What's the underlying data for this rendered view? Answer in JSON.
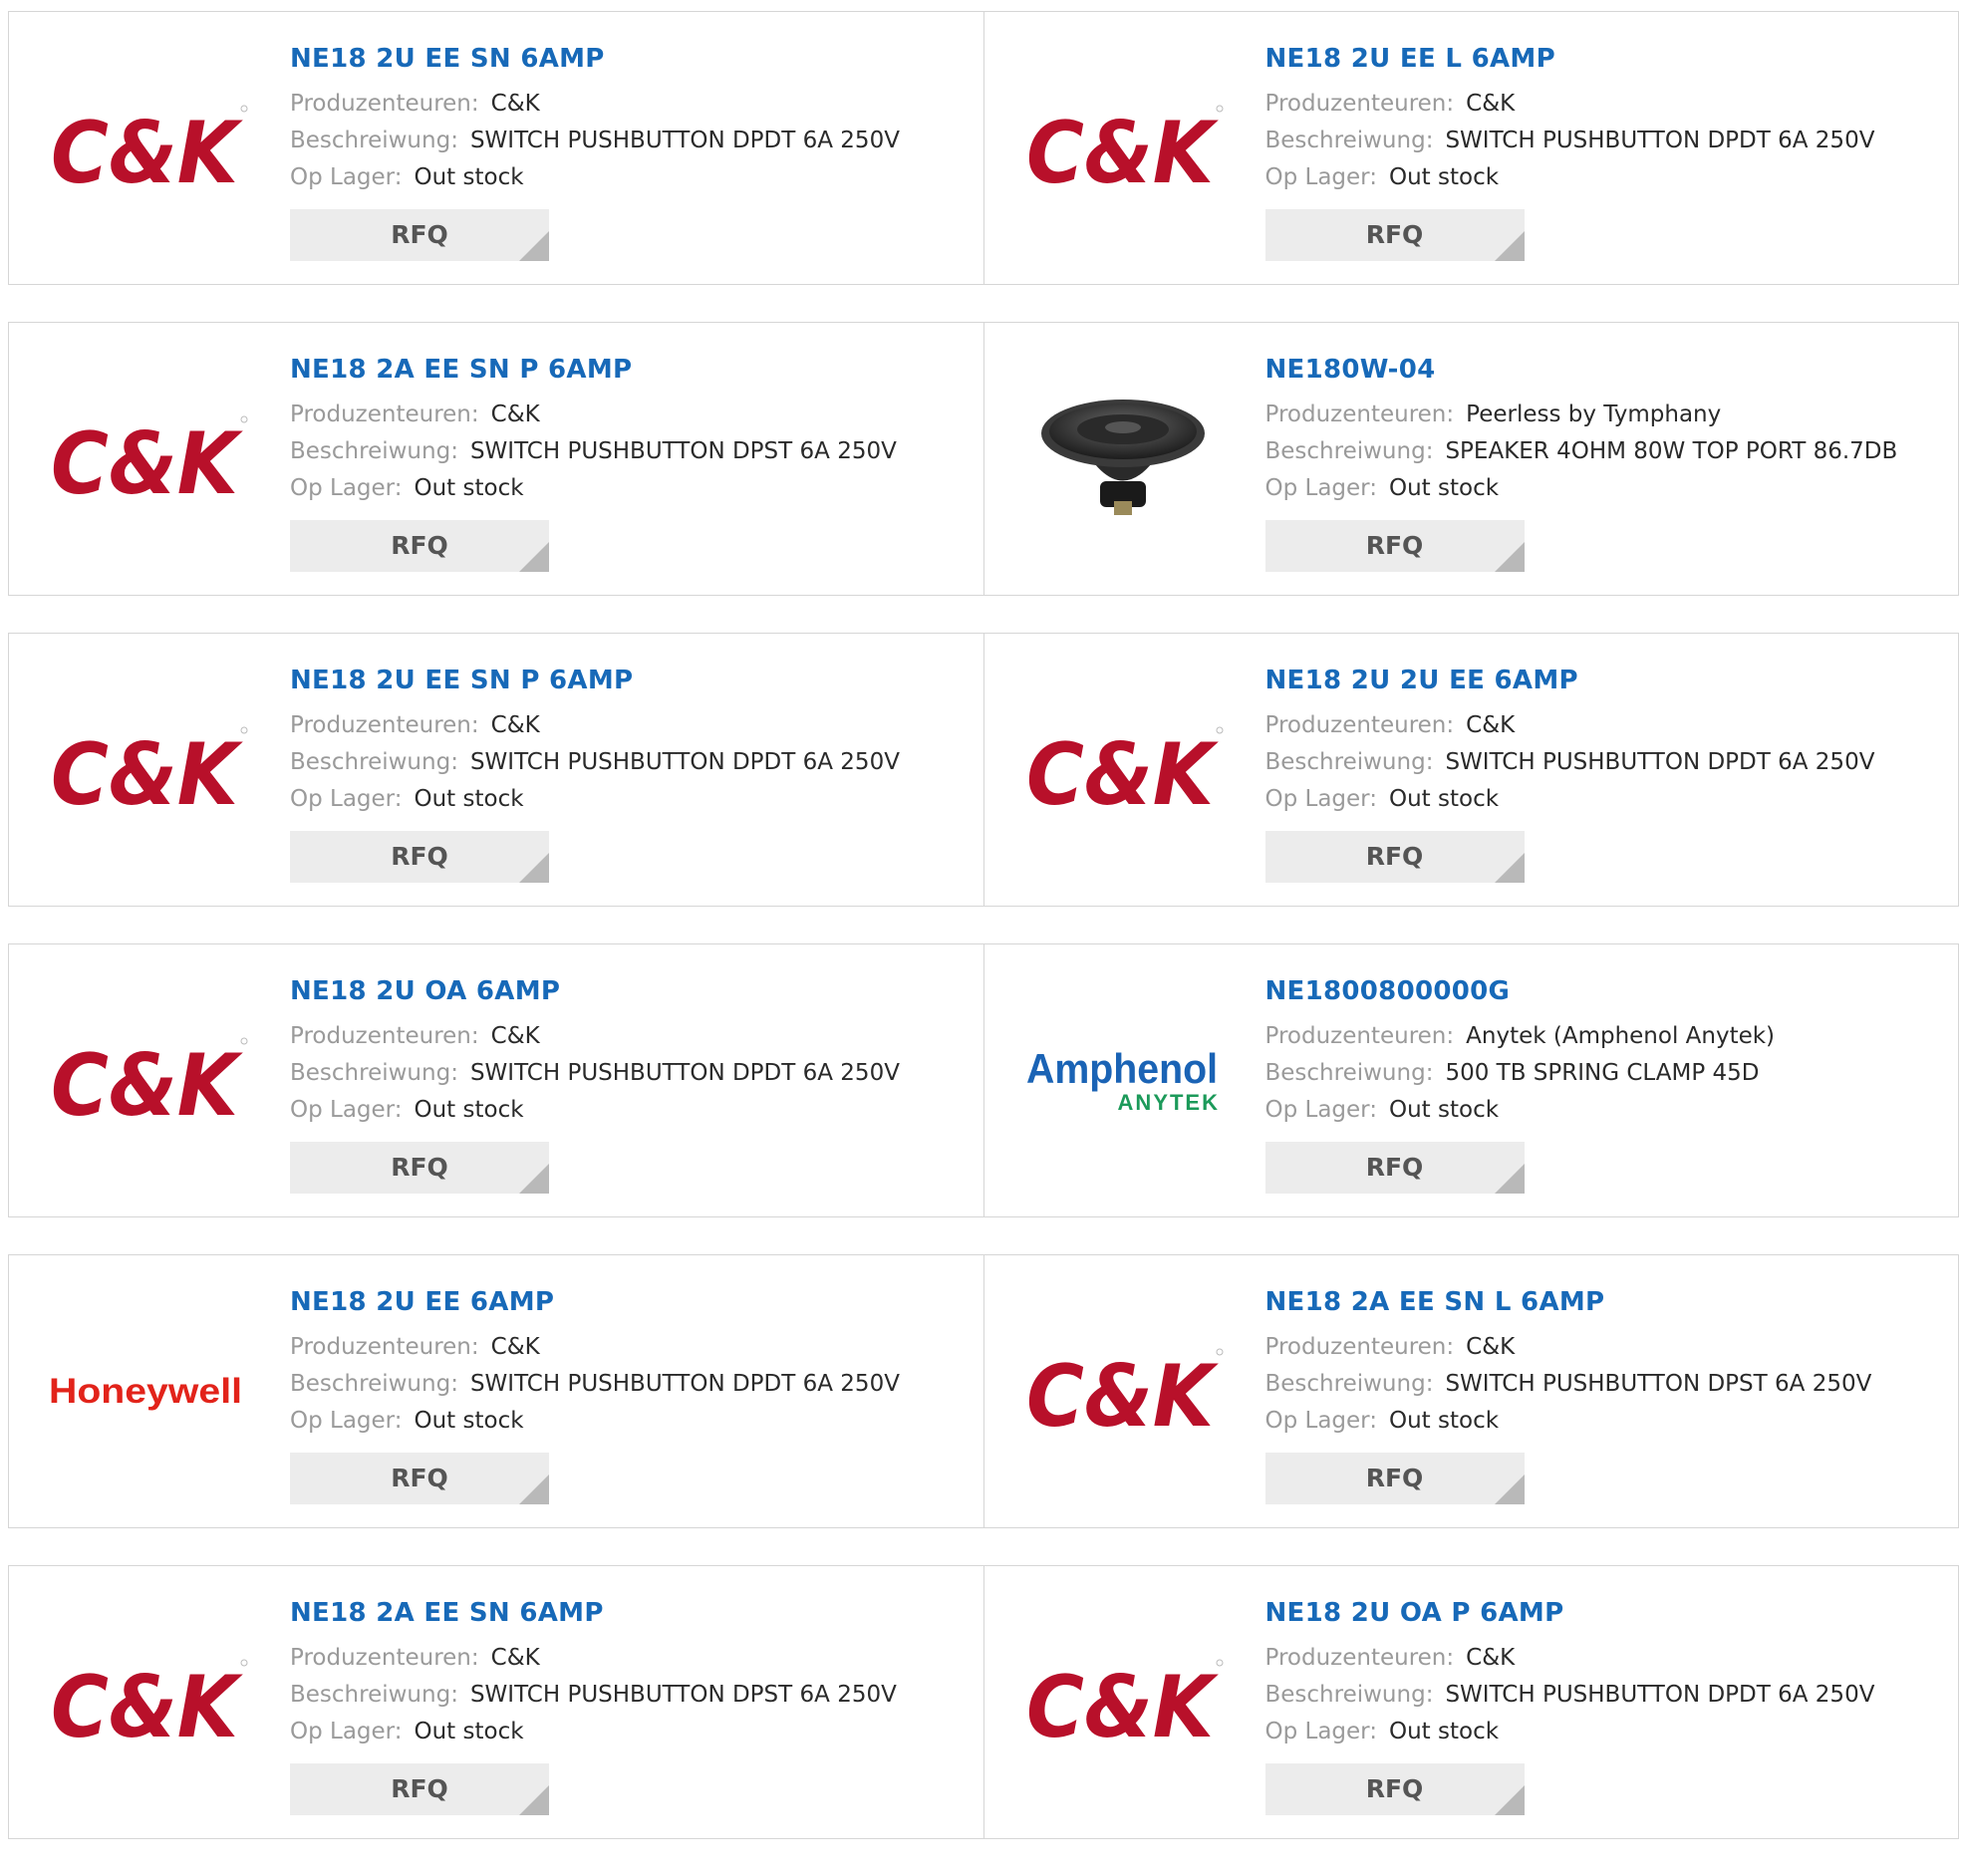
{
  "labels": {
    "manufacturer": "Produzenteuren:",
    "description": "Beschreiwung:",
    "stock": "Op Lager:",
    "rfq": "RFQ"
  },
  "colors": {
    "link": "#1769b8",
    "ck_red": "#b8102a",
    "honeywell_red": "#e2231a",
    "amphenol_blue": "#1a63b5",
    "anytek_green": "#1c9a5a",
    "rfq_bg": "#ececec"
  },
  "products": [
    {
      "part": "NE18 2U EE SN 6AMP",
      "manufacturer": "C&K",
      "description": "SWITCH PUSHBUTTON DPDT 6A 250V",
      "stock": "Out stock",
      "logo": "ck-logo",
      "logo_text": "C&K"
    },
    {
      "part": "NE18 2U EE L 6AMP",
      "manufacturer": "C&K",
      "description": "SWITCH PUSHBUTTON DPDT 6A 250V",
      "stock": "Out stock",
      "logo": "ck-logo",
      "logo_text": "C&K"
    },
    {
      "part": "NE18 2A EE SN P 6AMP",
      "manufacturer": "C&K",
      "description": "SWITCH PUSHBUTTON DPST 6A 250V",
      "stock": "Out stock",
      "logo": "ck-logo",
      "logo_text": "C&K"
    },
    {
      "part": "NE180W-04",
      "manufacturer": "Peerless by Tymphany",
      "description": "SPEAKER 4OHM 80W TOP PORT 86.7DB",
      "stock": "Out stock",
      "logo": "speaker-image"
    },
    {
      "part": "NE18 2U EE SN P 6AMP",
      "manufacturer": "C&K",
      "description": "SWITCH PUSHBUTTON DPDT 6A 250V",
      "stock": "Out stock",
      "logo": "ck-logo",
      "logo_text": "C&K"
    },
    {
      "part": "NE18 2U 2U EE 6AMP",
      "manufacturer": "C&K",
      "description": "SWITCH PUSHBUTTON DPDT 6A 250V",
      "stock": "Out stock",
      "logo": "ck-logo",
      "logo_text": "C&K"
    },
    {
      "part": "NE18 2U OA 6AMP",
      "manufacturer": "C&K",
      "description": "SWITCH PUSHBUTTON DPDT 6A 250V",
      "stock": "Out stock",
      "logo": "ck-logo",
      "logo_text": "C&K"
    },
    {
      "part": "NE1800800000G",
      "manufacturer": "Anytek (Amphenol Anytek)",
      "description": "500 TB SPRING CLAMP 45D",
      "stock": "Out stock",
      "logo": "amphenol-anytek-logo",
      "logo_text": "Amphenol",
      "logo_subtext": "ANYTEK"
    },
    {
      "part": "NE18 2U EE 6AMP",
      "manufacturer": "C&K",
      "description": "SWITCH PUSHBUTTON DPDT 6A 250V",
      "stock": "Out stock",
      "logo": "honeywell-logo",
      "logo_text": "Honeywell"
    },
    {
      "part": "NE18 2A EE SN L 6AMP",
      "manufacturer": "C&K",
      "description": "SWITCH PUSHBUTTON DPST 6A 250V",
      "stock": "Out stock",
      "logo": "ck-logo",
      "logo_text": "C&K"
    },
    {
      "part": "NE18 2A EE SN 6AMP",
      "manufacturer": "C&K",
      "description": "SWITCH PUSHBUTTON DPST 6A 250V",
      "stock": "Out stock",
      "logo": "ck-logo",
      "logo_text": "C&K"
    },
    {
      "part": "NE18 2U OA P 6AMP",
      "manufacturer": "C&K",
      "description": "SWITCH PUSHBUTTON DPDT 6A 250V",
      "stock": "Out stock",
      "logo": "ck-logo",
      "logo_text": "C&K"
    }
  ]
}
